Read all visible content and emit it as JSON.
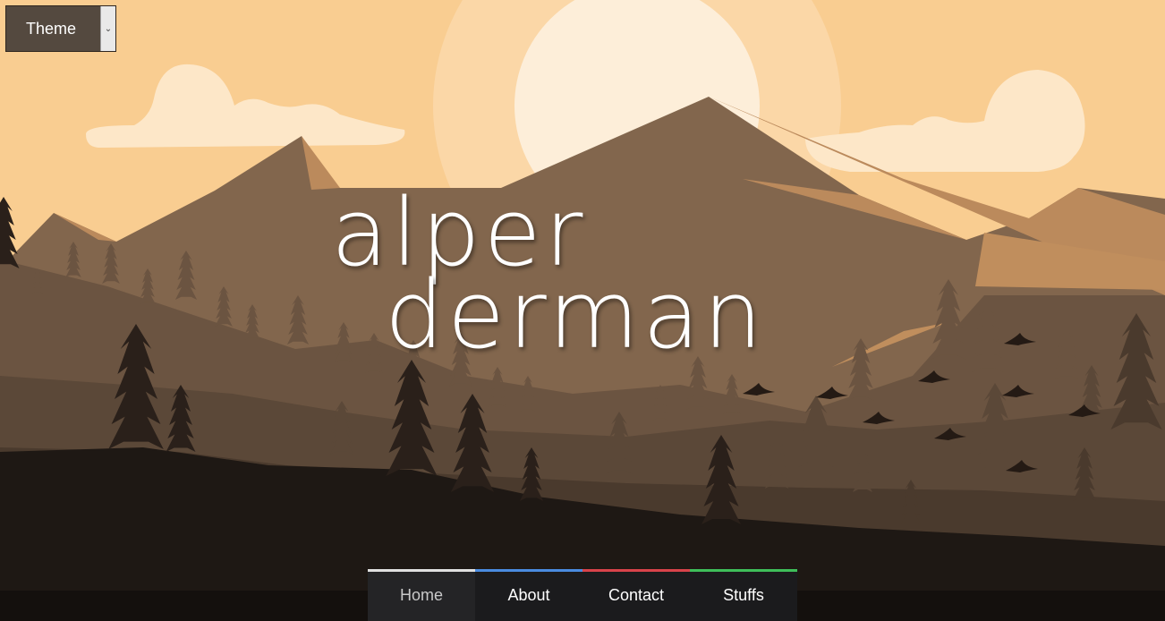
{
  "theme_selector": {
    "label": "Theme",
    "arrow_icon": "chevron-down-icon"
  },
  "logo": {
    "line1": "alper",
    "line2": "derman"
  },
  "nav": {
    "items": [
      {
        "label": "Home",
        "accent": "#e0e0e0",
        "active": true
      },
      {
        "label": "About",
        "accent": "#4a8be0",
        "active": false
      },
      {
        "label": "Contact",
        "accent": "#d9434a",
        "active": false
      },
      {
        "label": "Stuffs",
        "accent": "#3fbf5a",
        "active": false
      }
    ]
  },
  "colors": {
    "sky": "#f9cd91",
    "sun": "#fdeed9",
    "mountain_light": "#bb8a5c",
    "mountain_mid": "#82664d",
    "forest_mid": "#5b4838",
    "forest_dark": "#1e1814"
  }
}
